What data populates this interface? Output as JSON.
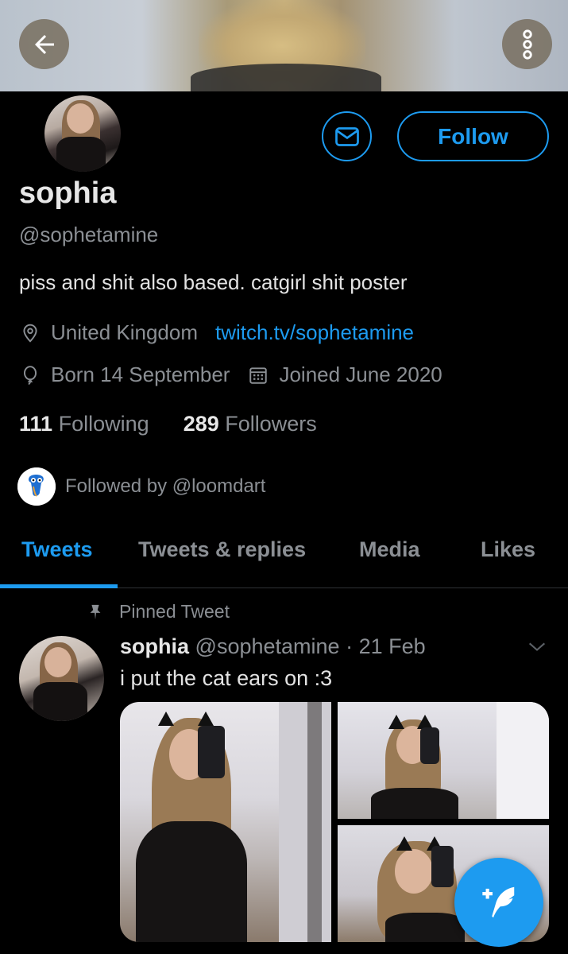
{
  "profile": {
    "name": "sophia",
    "handle": "@sophetamine",
    "bio": "piss and shit also based. catgirl shit poster",
    "location": "United Kingdom",
    "website": "twitch.tv/sophetamine",
    "birthday": "Born 14 September",
    "joined": "Joined June 2020",
    "following_count": "111",
    "following_label": "Following",
    "followers_count": "289",
    "followers_label": "Followers",
    "followed_by": "Followed by @loomdart"
  },
  "actions": {
    "follow_label": "Follow"
  },
  "tabs": [
    {
      "label": "Tweets",
      "active": true
    },
    {
      "label": "Tweets & replies",
      "active": false
    },
    {
      "label": "Media",
      "active": false
    },
    {
      "label": "Likes",
      "active": false
    }
  ],
  "pinned_tweet": {
    "pinned_label": "Pinned Tweet",
    "author_name": "sophia",
    "author_handle": "@sophetamine",
    "separator": "·",
    "date": "21 Feb",
    "text": "i put the cat ears on :3"
  },
  "icons": {
    "back": "arrow-left-icon",
    "more": "more-vertical-icon",
    "message": "envelope-icon",
    "location": "location-pin-icon",
    "birthday": "balloon-icon",
    "joined": "calendar-icon",
    "pin": "pin-icon",
    "chevron": "chevron-down-icon",
    "compose": "compose-tweet-icon"
  },
  "colors": {
    "accent": "#1d9bf0",
    "background": "#000000",
    "secondary_text": "#8b8f94"
  }
}
